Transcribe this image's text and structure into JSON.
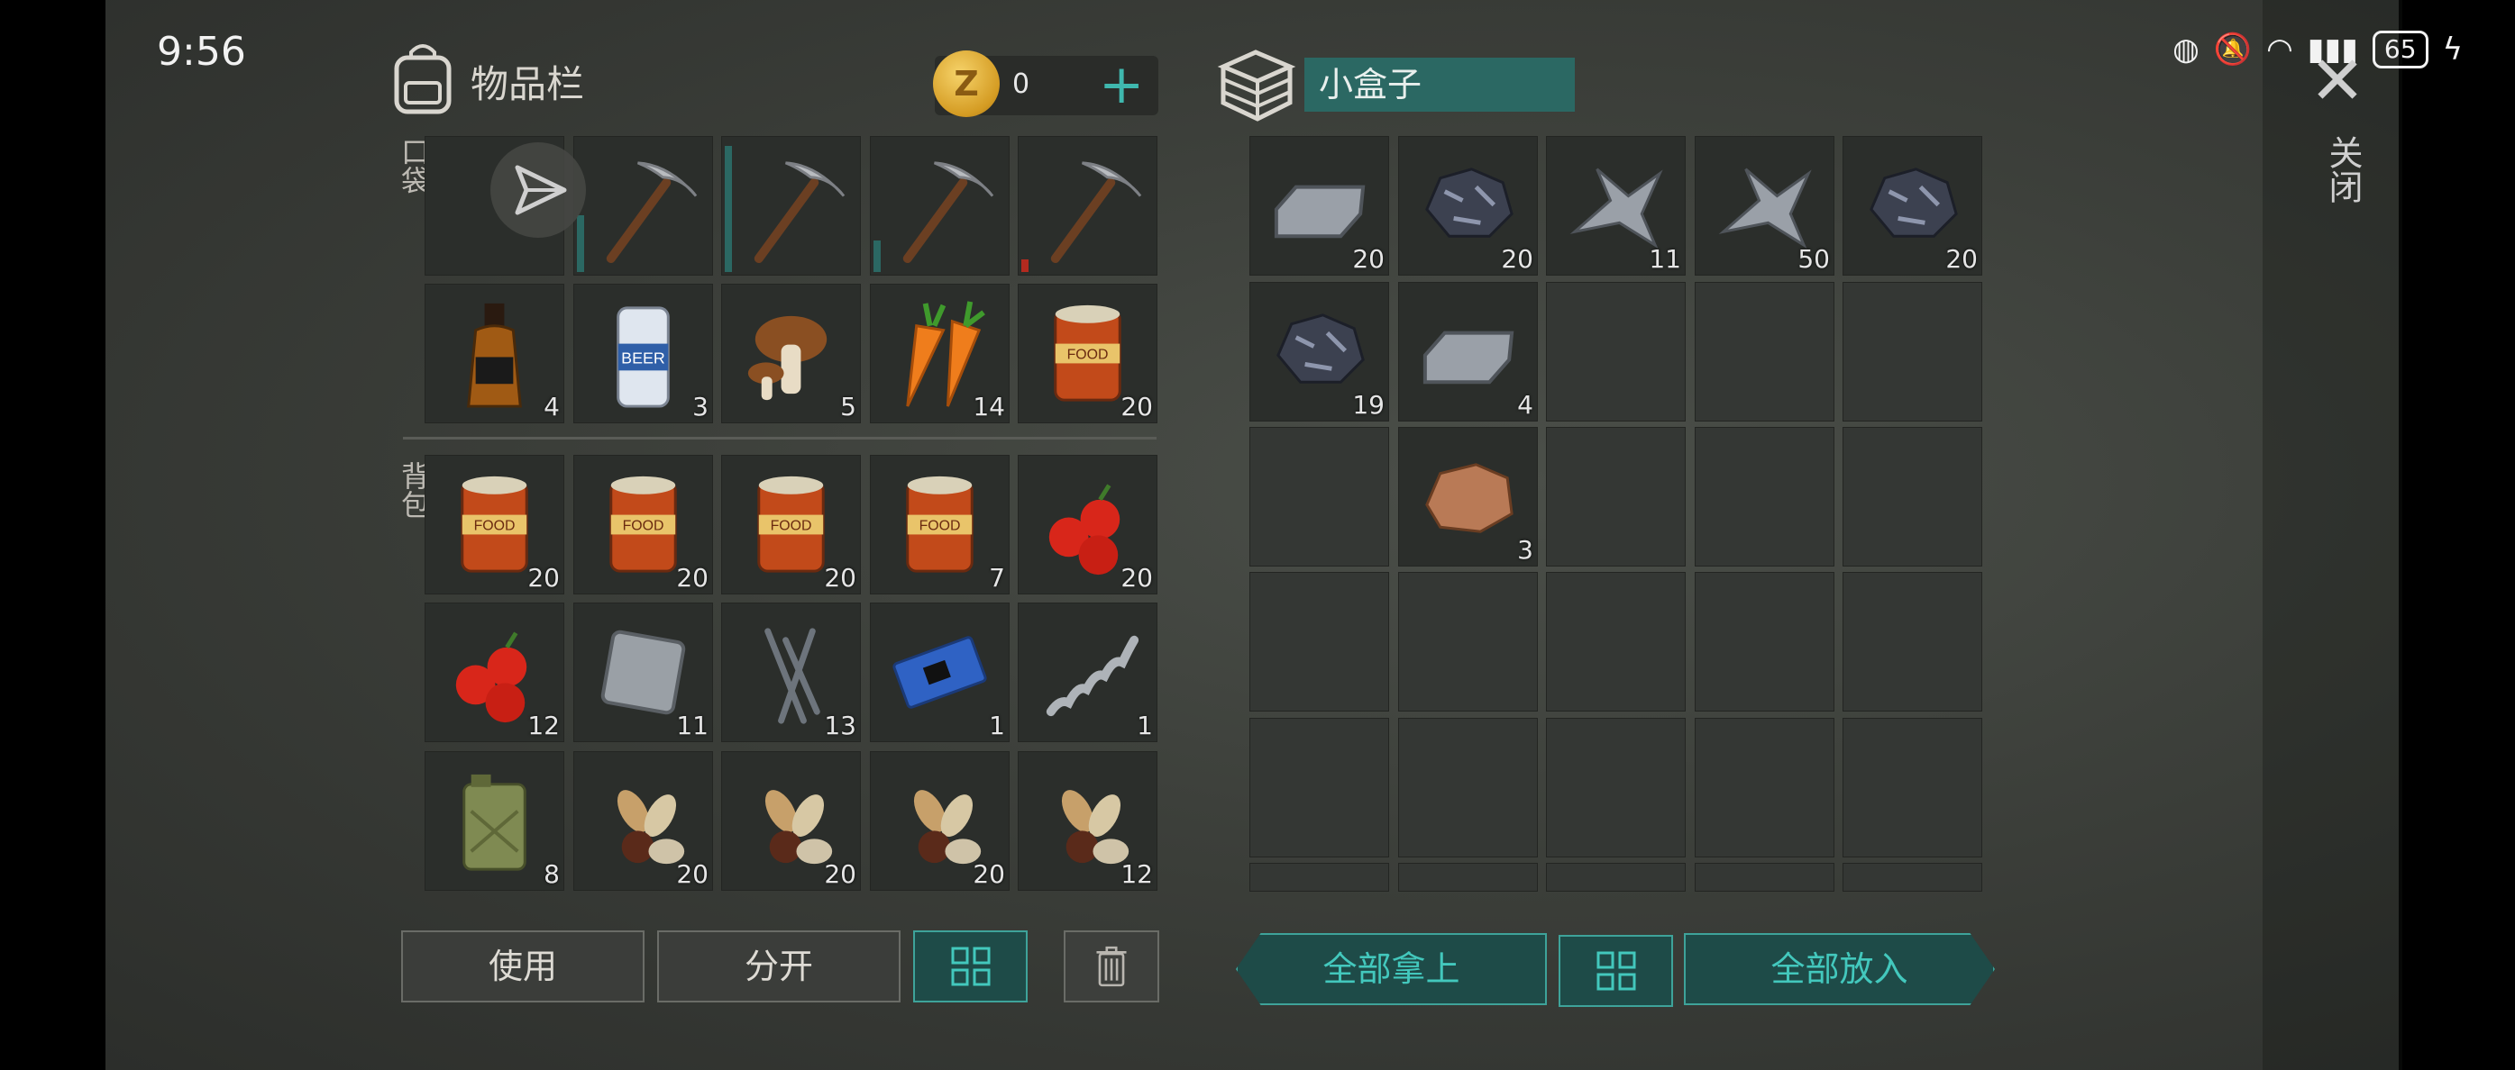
{
  "status": {
    "time": "9:56",
    "battery": "65"
  },
  "inventory": {
    "title": "物品栏",
    "pocket_label": "口袋",
    "backpack_label": "背包",
    "coins": "0",
    "pocket": [
      {
        "icon": "share-icon",
        "count": ""
      },
      {
        "icon": "pickaxe-icon",
        "count": "",
        "durability": 0.45
      },
      {
        "icon": "pickaxe-icon",
        "count": "",
        "durability": 1.0
      },
      {
        "icon": "pickaxe-icon",
        "count": "",
        "durability": 0.25
      },
      {
        "icon": "pickaxe-icon",
        "count": "",
        "durability": 0.1
      },
      {
        "icon": "whiskey-bottle-icon",
        "count": "4"
      },
      {
        "icon": "beer-can-icon",
        "count": "3"
      },
      {
        "icon": "mushroom-icon",
        "count": "5"
      },
      {
        "icon": "carrot-icon",
        "count": "14"
      },
      {
        "icon": "food-can-icon",
        "count": "20"
      }
    ],
    "backpack": [
      {
        "icon": "food-can-icon",
        "count": "20"
      },
      {
        "icon": "food-can-icon",
        "count": "20"
      },
      {
        "icon": "food-can-icon",
        "count": "20"
      },
      {
        "icon": "food-can-icon",
        "count": "7"
      },
      {
        "icon": "berries-icon",
        "count": "20"
      },
      {
        "icon": "berries-icon",
        "count": "12"
      },
      {
        "icon": "metal-plate-icon",
        "count": "11"
      },
      {
        "icon": "nails-icon",
        "count": "13"
      },
      {
        "icon": "circuit-board-icon",
        "count": "1"
      },
      {
        "icon": "spring-icon",
        "count": "1"
      },
      {
        "icon": "jerrycan-icon",
        "count": "8"
      },
      {
        "icon": "seeds-icon",
        "count": "20"
      },
      {
        "icon": "seeds-icon",
        "count": "20"
      },
      {
        "icon": "seeds-icon",
        "count": "20"
      },
      {
        "icon": "seeds-icon",
        "count": "12"
      }
    ],
    "buttons": {
      "use": "使用",
      "split": "分开"
    }
  },
  "box": {
    "name": "小盒子",
    "close_label": "关闭",
    "slots": [
      {
        "icon": "iron-ingot-icon",
        "count": "20"
      },
      {
        "icon": "coal-ore-icon",
        "count": "20"
      },
      {
        "icon": "scrap-metal-icon",
        "count": "11"
      },
      {
        "icon": "scrap-metal-icon",
        "count": "50"
      },
      {
        "icon": "coal-ore-icon",
        "count": "20"
      },
      {
        "icon": "coal-ore-icon",
        "count": "19"
      },
      {
        "icon": "iron-ingot-icon",
        "count": "4"
      },
      null,
      null,
      null,
      null,
      {
        "icon": "copper-ore-icon",
        "count": "3"
      },
      null,
      null,
      null
    ],
    "buttons": {
      "take_all": "全部拿上",
      "put_all": "全部放入"
    }
  },
  "colors": {
    "accent": "#3fb8ae",
    "box_name_bg": "#2b6863",
    "slot_bg": "#2b2e2b"
  }
}
